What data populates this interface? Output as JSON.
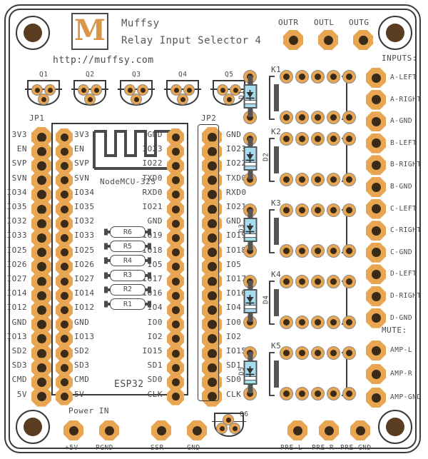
{
  "board": {
    "title_line1": "Muffsy",
    "title_line2": "Relay Input Selector 4",
    "url": "http://muffsy.com",
    "logo_letter": "M",
    "module_label": "ESP32",
    "module_name": "NodeMCU-32S",
    "colors": {
      "pad": "#e8a552",
      "pad_hole": "#3a2a18",
      "silk": "#4a4a4a",
      "diode_body": "#a8dcf0",
      "logo": "#d9974a",
      "mount_hole": "#5a3c20"
    }
  },
  "outputs": {
    "labels": [
      "OUTR",
      "OUTL",
      "OUTG"
    ]
  },
  "inputs": {
    "heading": "INPUTS:",
    "labels": [
      "A-LEFT",
      "A-RIGHT",
      "A-GND",
      "B-LEFT",
      "B-RIGHT",
      "B-GND",
      "C-LEFT",
      "C-RIGHT",
      "C-GND",
      "D-LEFT",
      "D-RIGHT",
      "D-GND"
    ]
  },
  "mute": {
    "heading": "MUTE:",
    "labels": [
      "AMP-L",
      "AMP-R",
      "AMP-GND"
    ]
  },
  "preout": {
    "labels": [
      "PRE-L",
      "PRE-R",
      "PRE-GND"
    ]
  },
  "power": {
    "heading": "Power IN",
    "labels": [
      "+5V",
      "PGND"
    ]
  },
  "ssr": {
    "labels": [
      "SSR",
      "GND"
    ]
  },
  "headers": {
    "jp1_label": "JP1",
    "jp2_label": "JP2",
    "left_pins": [
      "3V3",
      "EN",
      "SVP",
      "SVN",
      "IO34",
      "IO35",
      "IO32",
      "IO33",
      "IO25",
      "IO26",
      "IO27",
      "IO14",
      "IO12",
      "GND",
      "IO13",
      "SD2",
      "SD3",
      "CMD",
      "5V"
    ],
    "right_pins": [
      "GND",
      "IO23",
      "IO22",
      "TXD0",
      "RXD0",
      "IO21",
      "GND",
      "IO19",
      "IO18",
      "IO5",
      "IO17",
      "IO16",
      "IO4",
      "IO0",
      "IO2",
      "IO15",
      "SD1",
      "SD0",
      "CLK"
    ]
  },
  "relays": {
    "labels": [
      "K1",
      "K2",
      "K3",
      "K4",
      "K5"
    ]
  },
  "diodes": {
    "labels": [
      "D1",
      "D2",
      "D3",
      "D4",
      "D5"
    ]
  },
  "resistors": {
    "labels": [
      "R6",
      "R5",
      "R4",
      "R3",
      "R2",
      "R1"
    ]
  },
  "transistors": {
    "top_labels": [
      "Q1",
      "Q2",
      "Q3",
      "Q4",
      "Q5"
    ],
    "bottom_label": "Q6"
  }
}
